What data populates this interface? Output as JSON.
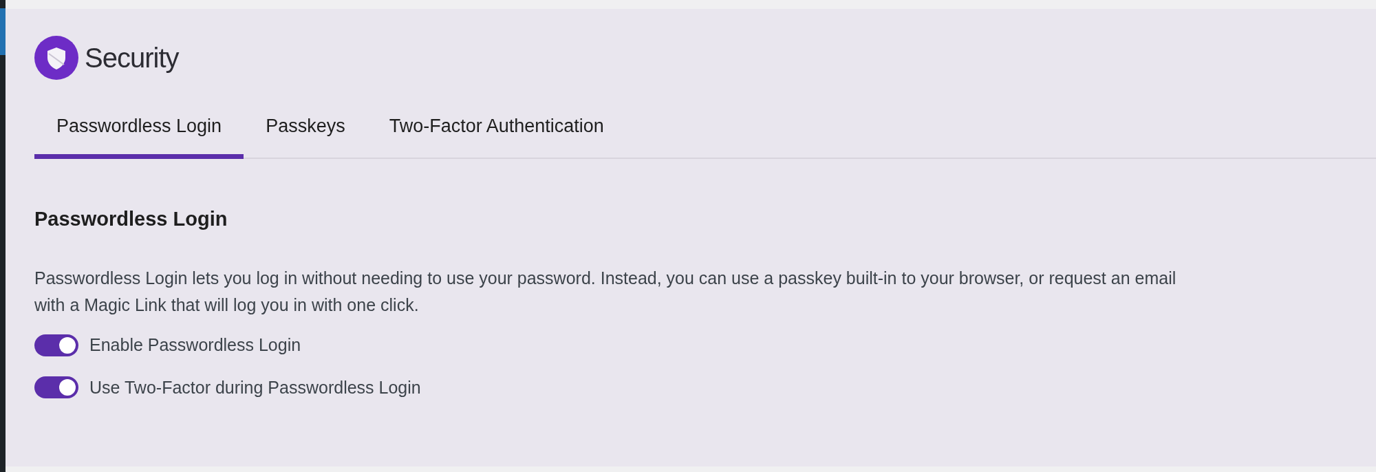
{
  "page": {
    "title": "Security"
  },
  "tabs": [
    {
      "label": "Passwordless Login",
      "selected": true
    },
    {
      "label": "Passkeys",
      "selected": false
    },
    {
      "label": "Two-Factor Authentication",
      "selected": false
    }
  ],
  "section": {
    "heading": "Passwordless Login",
    "description": "Passwordless Login lets you log in without needing to use your password. Instead, you can use a passkey built-in to your browser, or request an email with a Magic Link that will log you in with one click."
  },
  "toggles": [
    {
      "label": "Enable Passwordless Login",
      "on": true
    },
    {
      "label": "Use Two-Factor during Passwordless Login",
      "on": true
    }
  ]
}
